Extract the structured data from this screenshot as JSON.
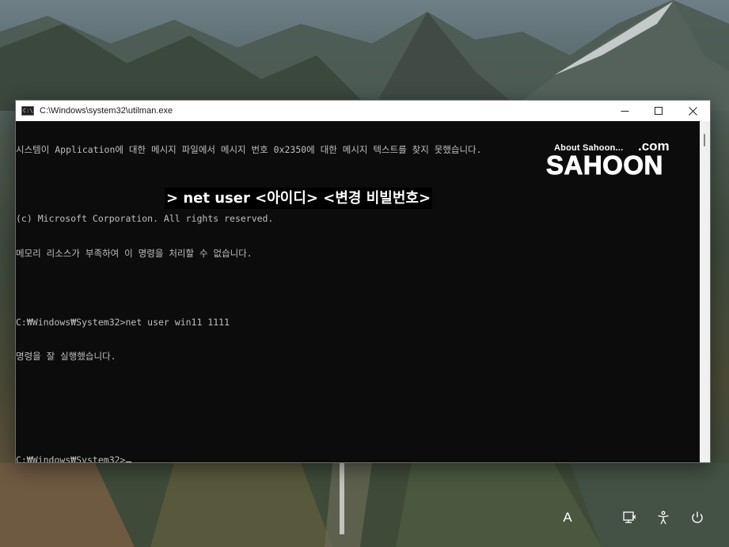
{
  "window": {
    "title": "C:\\Windows\\system32\\utilman.exe",
    "icon_label": "C:\\"
  },
  "console": {
    "lines": [
      "시스템이 Application에 대한 메시지 파일에서 메시지 번호 0x2350에 대한 메시지 텍스트를 찾지 못했습니다.",
      "",
      "(c) Microsoft Corporation. All rights reserved.",
      "메모리 리소스가 부족하여 이 명령을 처리할 수 없습니다.",
      "",
      "C:₩Windows₩System32>net user win11 1111",
      "명령을 잘 실행했습니다.",
      "",
      "",
      "C:₩Windows₩System32>"
    ]
  },
  "annotation": {
    "text": "> net user <아이디> <변경 비빌번호>"
  },
  "watermark": {
    "small": "About Sahoon...",
    "com": ".com",
    "main": "SAHOON"
  },
  "lockscreen": {
    "language_indicator": "A"
  },
  "icons": {
    "app": "console-icon",
    "minimize": "minimize-icon",
    "maximize": "maximize-icon",
    "close": "close-icon",
    "network": "network-icon",
    "accessibility": "accessibility-icon",
    "power": "power-icon"
  }
}
